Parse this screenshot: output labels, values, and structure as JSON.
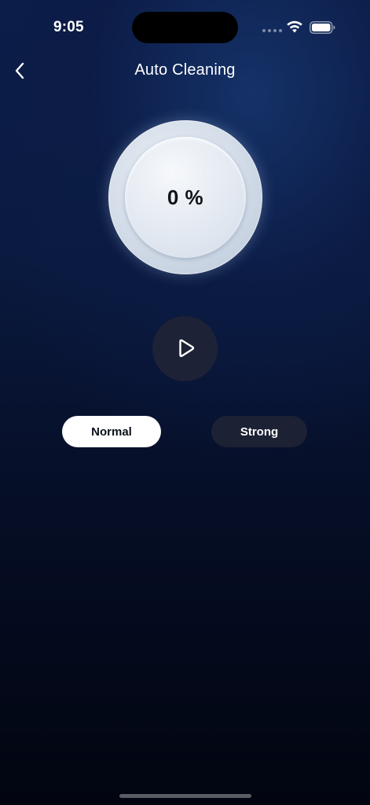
{
  "status_bar": {
    "time": "9:05",
    "icons": [
      "cellular-dots-icon",
      "wifi-icon",
      "battery-icon"
    ]
  },
  "header": {
    "back_icon": "chevron-left-icon",
    "title": "Auto Cleaning"
  },
  "progress": {
    "value_text": "0 %",
    "percent": 0
  },
  "controls": {
    "play_icon": "play-icon"
  },
  "modes": {
    "normal_label": "Normal",
    "strong_label": "Strong",
    "selected": "Normal"
  },
  "colors": {
    "background_top": "#0b1d4a",
    "background_bottom": "#020510",
    "selected_mode_bg": "#ffffff",
    "unselected_mode_bg": "#1c2134",
    "play_button_bg": "#1d2236"
  }
}
